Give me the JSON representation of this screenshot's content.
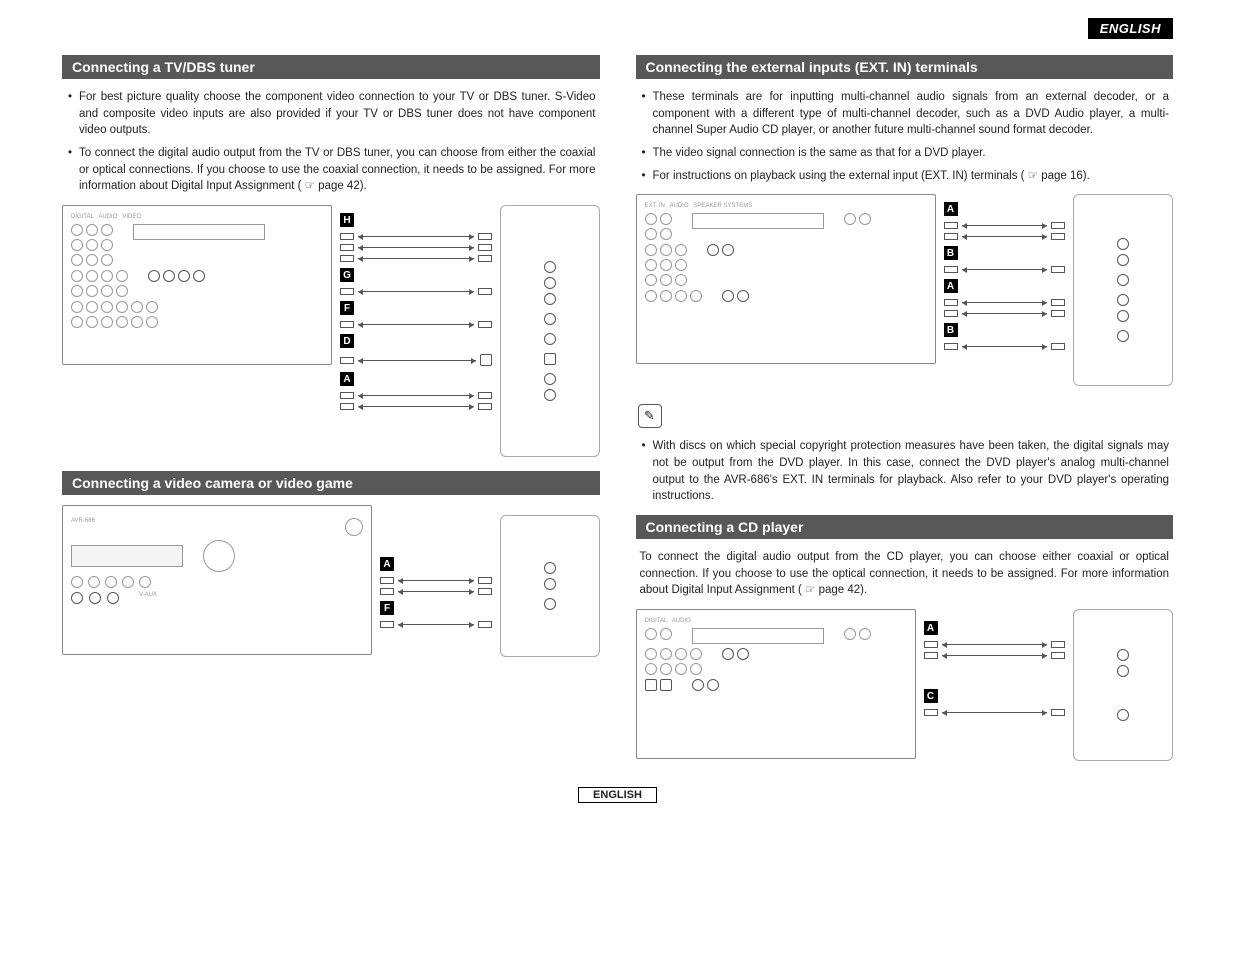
{
  "language_label": "ENGLISH",
  "footer_language": "ENGLISH",
  "page_ref_icon": "☞",
  "left": {
    "s1": {
      "heading": "Connecting a TV/DBS tuner",
      "bullets": [
        "For best picture quality choose the component video connection to your TV or DBS tuner. S-Video and composite video inputs are also provided if your TV or DBS tuner does not have component video outputs.",
        "To connect the digital audio output from the TV or DBS tuner, you can choose from either the coaxial or optical connections. If you choose to use the coaxial connection, it needs to be assigned. For more information about Digital Input Assignment ( ☞ page 42)."
      ],
      "diagram_labels": [
        "H",
        "G",
        "F",
        "D",
        "A"
      ]
    },
    "s2": {
      "heading": "Connecting a video camera or video game",
      "diagram_labels": [
        "A",
        "F"
      ]
    }
  },
  "right": {
    "s1": {
      "heading": "Connecting the external inputs (EXT. IN) terminals",
      "bullets": [
        "These terminals are for inputting multi-channel audio signals from an external decoder, or a component with a different type of multi-channel decoder, such as a DVD Audio player, a multi-channel Super Audio CD player, or another future multi-channel sound format decoder.",
        "The video signal connection is the same as that for a DVD player.",
        "For instructions on playback using the external input (EXT. IN) terminals ( ☞ page 16)."
      ],
      "diagram_labels": [
        "A",
        "B",
        "A",
        "B"
      ]
    },
    "note": {
      "icon": "✎",
      "bullets": [
        "With discs on which special copyright protection measures have been taken, the digital signals may not be output from the DVD player. In this case, connect the DVD player's analog multi-channel output to the AVR-686's EXT. IN terminals for playback. Also refer to your DVD player's operating instructions."
      ]
    },
    "s2": {
      "heading": "Connecting a CD player",
      "paragraph": "To connect the digital audio output from the CD player, you can choose either coaxial or optical connection. If you choose to use the optical connection, it needs to be assigned. For more information about Digital Input Assignment ( ☞ page 42).",
      "diagram_labels": [
        "A",
        "C"
      ]
    }
  }
}
